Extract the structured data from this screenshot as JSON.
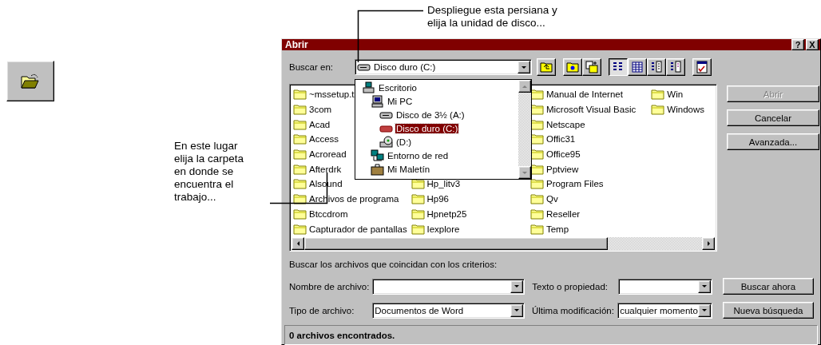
{
  "callouts": [
    {
      "text": "Despliegue esta persiana y\nelija la unidad de disco..."
    },
    {
      "text": "En este lugar\nelija la carpeta\nen donde se\nencuentra el\ntrabajo..."
    }
  ],
  "dialog": {
    "title": "Abrir",
    "title_buttons": [
      "?",
      "X"
    ],
    "look_in": {
      "label": "Buscar en:",
      "value": "Disco duro (C:)"
    },
    "toolbar_groups": [
      [
        {
          "kind": "up"
        }
      ],
      [
        {
          "kind": "favorites"
        },
        {
          "kind": "add-favorite"
        }
      ],
      [
        {
          "kind": "list",
          "selected": true
        },
        {
          "kind": "details",
          "selected": false
        },
        {
          "kind": "properties",
          "selected": false
        },
        {
          "kind": "preview",
          "selected": false
        }
      ],
      [
        {
          "kind": "commands"
        }
      ]
    ],
    "dropdown": [
      {
        "label": "Escritorio",
        "kind": "desktop",
        "selected": false,
        "children": [
          {
            "label": "Mi PC",
            "kind": "computer",
            "selected": false,
            "children": [
              {
                "label": "Disco de 3½ (A:)",
                "kind": "floppy",
                "selected": false
              },
              {
                "label": "Disco duro (C:)",
                "kind": "harddisk",
                "selected": true
              },
              {
                "label": "(D:)",
                "kind": "cdrom",
                "selected": false
              }
            ]
          },
          {
            "label": "Entorno de red",
            "kind": "network",
            "selected": false
          },
          {
            "label": "Mi Maletín",
            "kind": "briefcase",
            "selected": false
          }
        ]
      }
    ],
    "file_columns": [
      [
        "~mssetup.t",
        "3com",
        "Acad",
        "Access",
        "Acroread",
        "Afterdrk",
        "Alsound",
        "Archivos de programa",
        "Btccdrom",
        "Capturador de pantallas"
      ],
      [
        "Hp_litv3",
        "Hp96",
        "Hpnetp25",
        "Iexplore"
      ],
      [
        "Manual de Internet",
        "Microsoft Visual Basic",
        "Netscape",
        "Offic31",
        "Office95",
        "Pptview",
        "Program Files",
        "Qv",
        "Reseller",
        "Temp"
      ],
      [
        "Win",
        "Windows"
      ]
    ],
    "side_buttons": [
      {
        "label": "Abrir",
        "disabled": true
      },
      {
        "label": "Cancelar",
        "disabled": false
      },
      {
        "label": "Avanzada...",
        "disabled": false
      }
    ],
    "criteria_label": "Buscar los archivos que coincidan con los criterios:",
    "criteria": [
      {
        "label": "Nombre de archivo:",
        "label2": "Texto o propiedad:",
        "button": "Buscar ahora"
      },
      {
        "label": "Tipo de archivo:",
        "value": "Documentos de Word",
        "label2": "Última modificación:",
        "value2": "cualquier momento",
        "button": "Nueva búsqueda"
      }
    ],
    "status": "0 archivos encontrados."
  }
}
